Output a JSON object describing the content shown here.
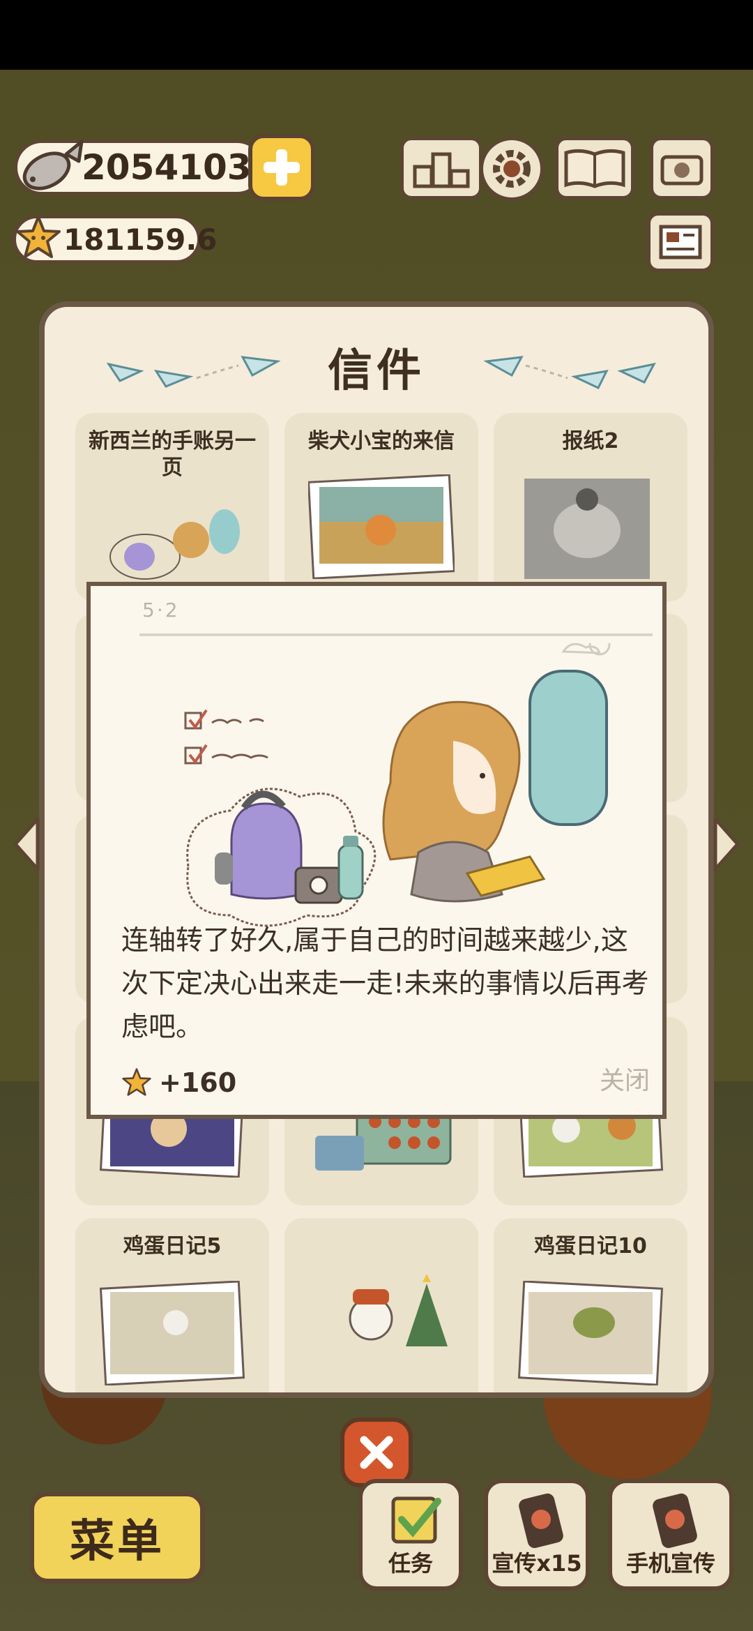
{
  "hud": {
    "fish_count": "2054103",
    "star_count": "181159.6",
    "icons": [
      "fish-icon",
      "star-icon",
      "plus-icon",
      "ranking-icon",
      "settings-gear-icon",
      "album-book-icon",
      "camera-icon",
      "newspaper-icon"
    ]
  },
  "panel": {
    "title": "信件",
    "cards": [
      {
        "title": "新西兰的手账另一页"
      },
      {
        "title": "柴犬小宝的来信"
      },
      {
        "title": "报纸2"
      },
      {
        "title": "鸡蛋日记5"
      },
      {
        "title": ""
      },
      {
        "title": "鸡蛋日记10"
      }
    ]
  },
  "letter": {
    "date": "5·2",
    "text": "连轴转了好久,属于自己的时间越来越少,这次下定决心出来走一走!未来的事情以后再考虑吧。",
    "reward": "+160",
    "close_label": "关闭"
  },
  "bottom_bar": {
    "menu_label": "菜单",
    "task_label": "任务",
    "promo_label": "宣传x15",
    "phone_promo_label": "手机宣传"
  },
  "colors": {
    "panel_bg": "#f5ecdc",
    "border": "#6b5847",
    "accent_yellow": "#f7c842",
    "close_red": "#d4562c"
  }
}
